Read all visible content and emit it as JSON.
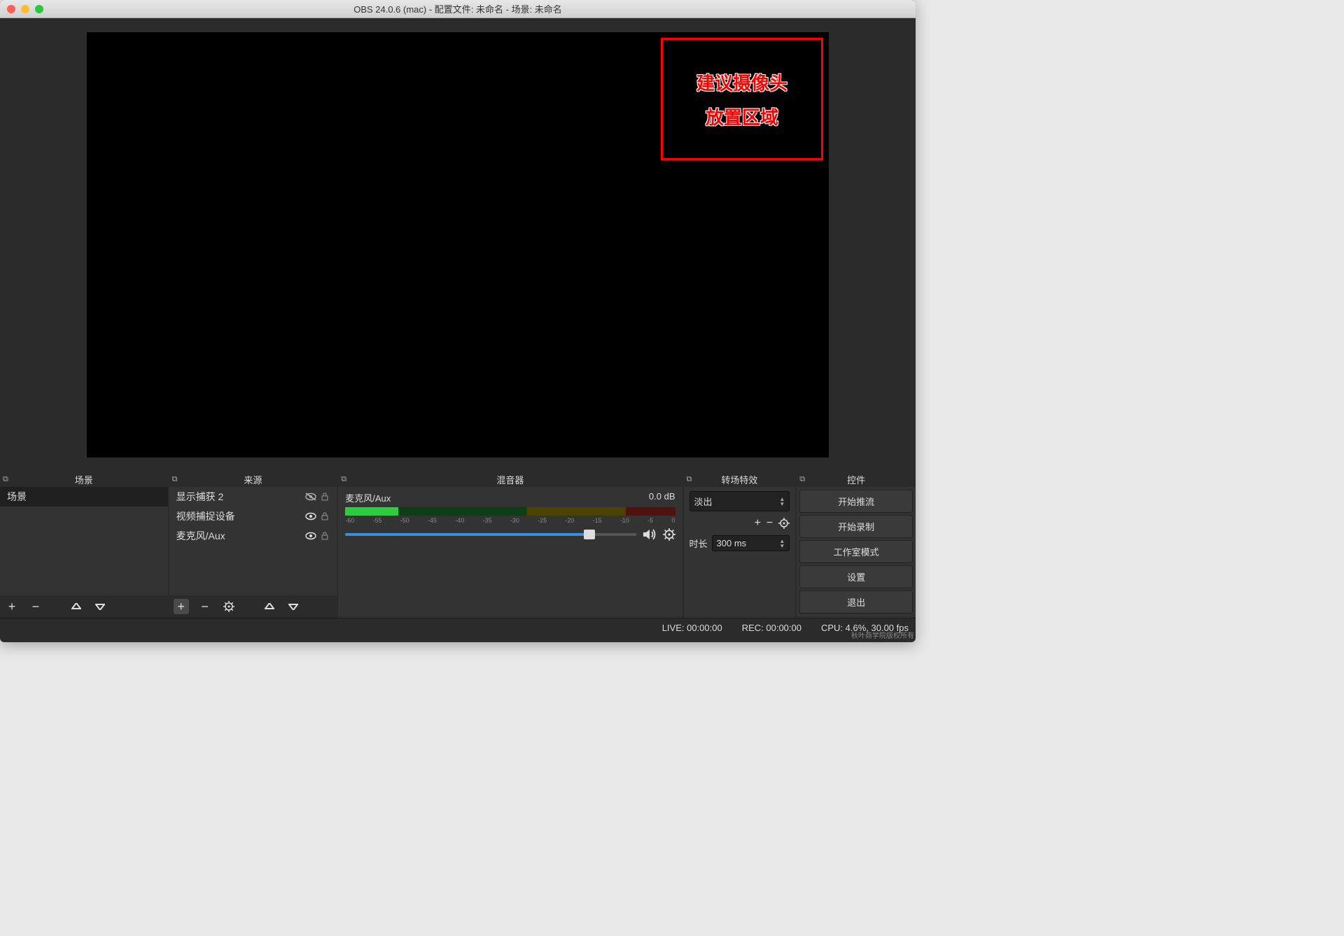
{
  "window": {
    "title": "OBS 24.0.6 (mac) - 配置文件: 未命名 - 场景: 未命名"
  },
  "preview": {
    "camera_hint_line1": "建议摄像头",
    "camera_hint_line2": "放置区域"
  },
  "panels": {
    "scenes": {
      "title": "场景",
      "items": [
        "场景"
      ]
    },
    "sources": {
      "title": "来源",
      "items": [
        {
          "label": "显示捕获 2",
          "visible": false,
          "locked": false
        },
        {
          "label": "视频捕捉设备",
          "visible": true,
          "locked": false
        },
        {
          "label": "麦克风/Aux",
          "visible": true,
          "locked": false
        }
      ]
    },
    "mixer": {
      "title": "混音器",
      "items": [
        {
          "name": "麦克风/Aux",
          "level_db": "0.0 dB",
          "scale": [
            "-60",
            "-55",
            "-50",
            "-45",
            "-40",
            "-35",
            "-30",
            "-25",
            "-20",
            "-15",
            "-10",
            "-5",
            "0"
          ]
        }
      ]
    },
    "transitions": {
      "title": "转场特效",
      "selected": "淡出",
      "duration_label": "时长",
      "duration_value": "300 ms"
    },
    "controls": {
      "title": "控件",
      "buttons": [
        "开始推流",
        "开始录制",
        "工作室模式",
        "设置",
        "退出"
      ]
    }
  },
  "statusbar": {
    "live": "LIVE: 00:00:00",
    "rec": "REC: 00:00:00",
    "cpu": "CPU: 4.6%, 30.00 fps"
  },
  "watermark": "秋叶商学院版权所有"
}
